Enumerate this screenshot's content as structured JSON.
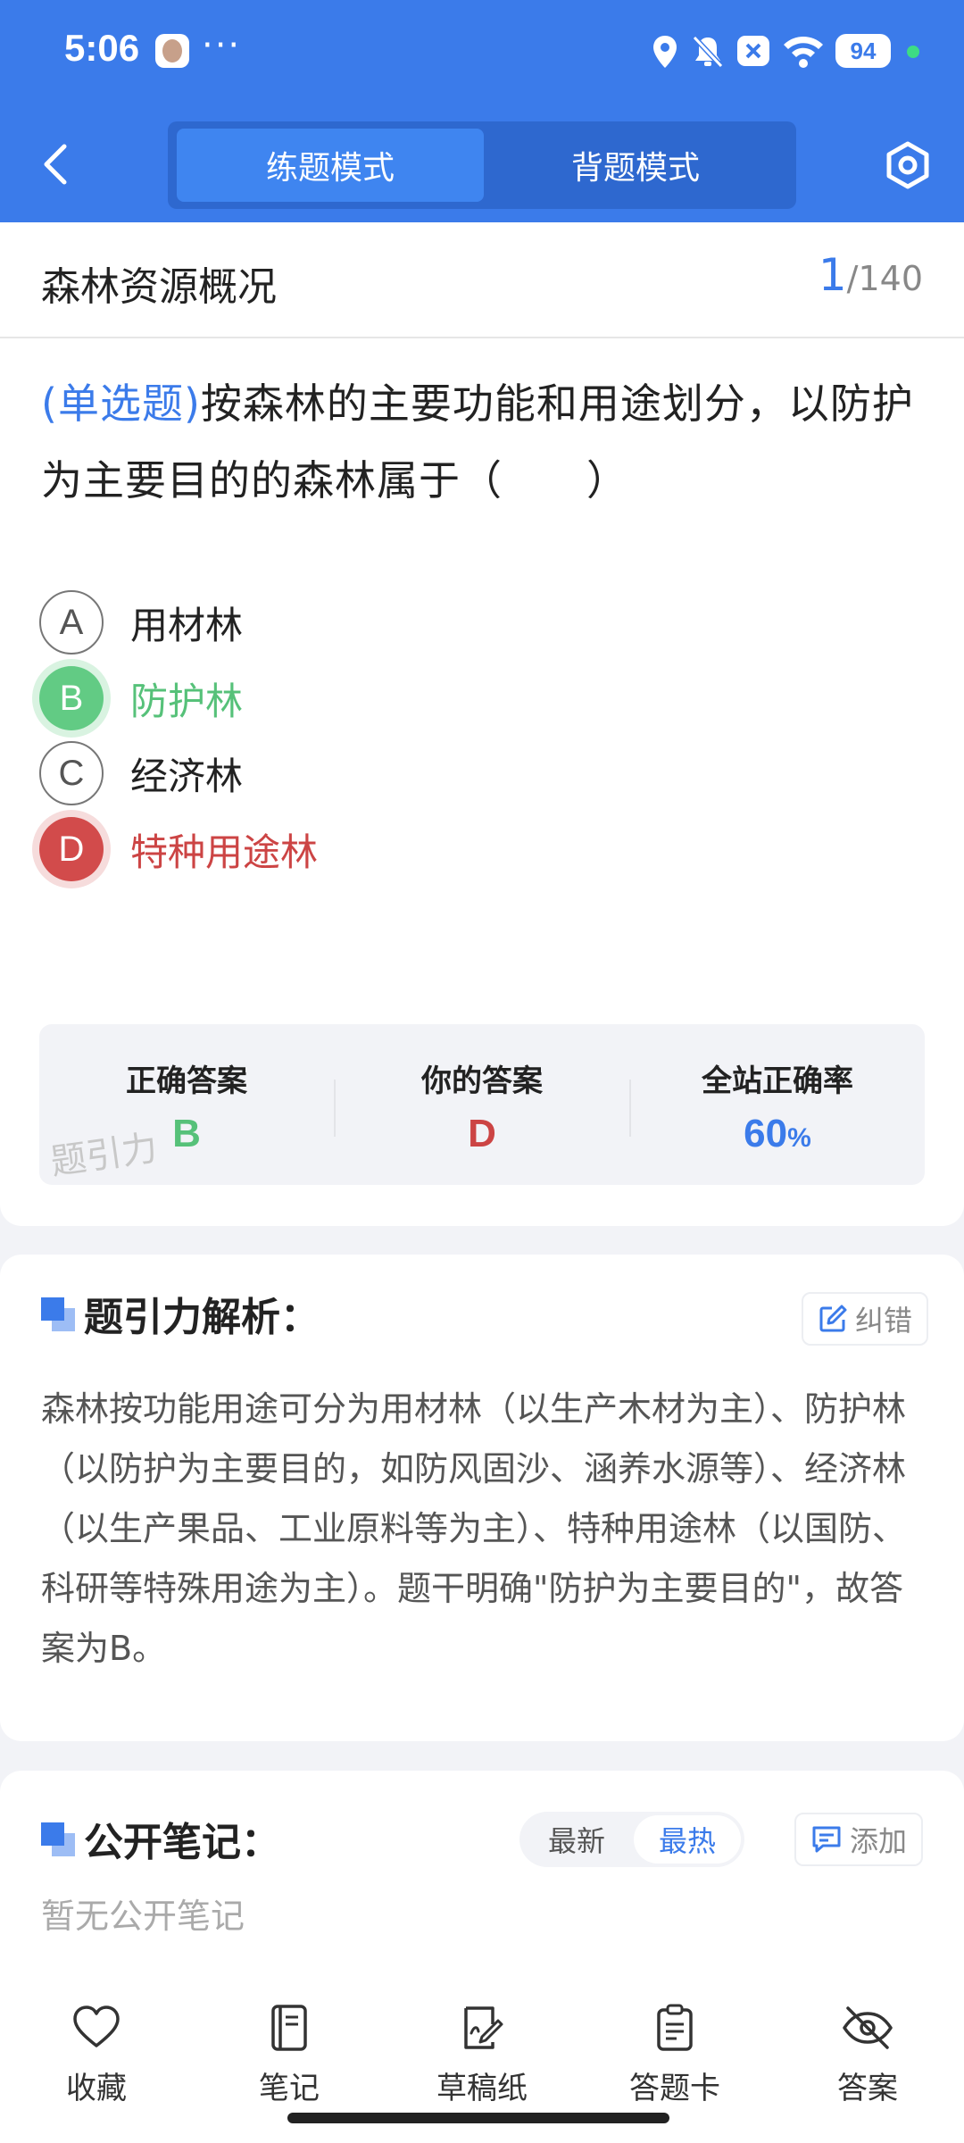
{
  "status_bar": {
    "time": "5:06",
    "more": "···",
    "battery": "94"
  },
  "header": {
    "mode_tabs": [
      {
        "label": "练题模式",
        "active": true
      },
      {
        "label": "背题模式",
        "active": false
      }
    ]
  },
  "question": {
    "section": "森林资源概况",
    "current": "1",
    "total": "/140",
    "type_label": "(单选题)",
    "text": "按森林的主要功能和用途划分，以防护为主要目的的森林属于（　　）",
    "options": [
      {
        "key": "A",
        "text": "用材林",
        "state": "normal"
      },
      {
        "key": "B",
        "text": "防护林",
        "state": "correct"
      },
      {
        "key": "C",
        "text": "经济林",
        "state": "normal"
      },
      {
        "key": "D",
        "text": "特种用途林",
        "state": "wrong"
      }
    ],
    "stats": {
      "correct_label": "正确答案",
      "correct_value": "B",
      "yours_label": "你的答案",
      "yours_value": "D",
      "rate_label": "全站正确率",
      "rate_value": "60",
      "rate_unit": "%"
    },
    "watermark": "题引力"
  },
  "analysis": {
    "title": "题引力解析：",
    "report_label": "纠错",
    "text": "森林按功能用途可分为用材林（以生产木材为主）、防护林（以防护为主要目的，如防风固沙、涵养水源等）、经济林（以生产果品、工业原料等为主）、特种用途林（以国防、科研等特殊用途为主）。题干明确\"防护为主要目的\"，故答案为B。"
  },
  "notes": {
    "title": "公开笔记：",
    "sort_latest": "最新",
    "sort_hottest": "最热",
    "add_label": "添加",
    "empty_text": "暂无公开笔记"
  },
  "bottom_nav": [
    {
      "label": "收藏",
      "icon": "heart-icon"
    },
    {
      "label": "笔记",
      "icon": "notebook-icon"
    },
    {
      "label": "草稿纸",
      "icon": "draft-paper-icon"
    },
    {
      "label": "答题卡",
      "icon": "answer-sheet-icon"
    },
    {
      "label": "答案",
      "icon": "eye-off-icon"
    }
  ],
  "colors": {
    "primary": "#3b7bea",
    "correct": "#56c179",
    "wrong": "#cc4444"
  }
}
